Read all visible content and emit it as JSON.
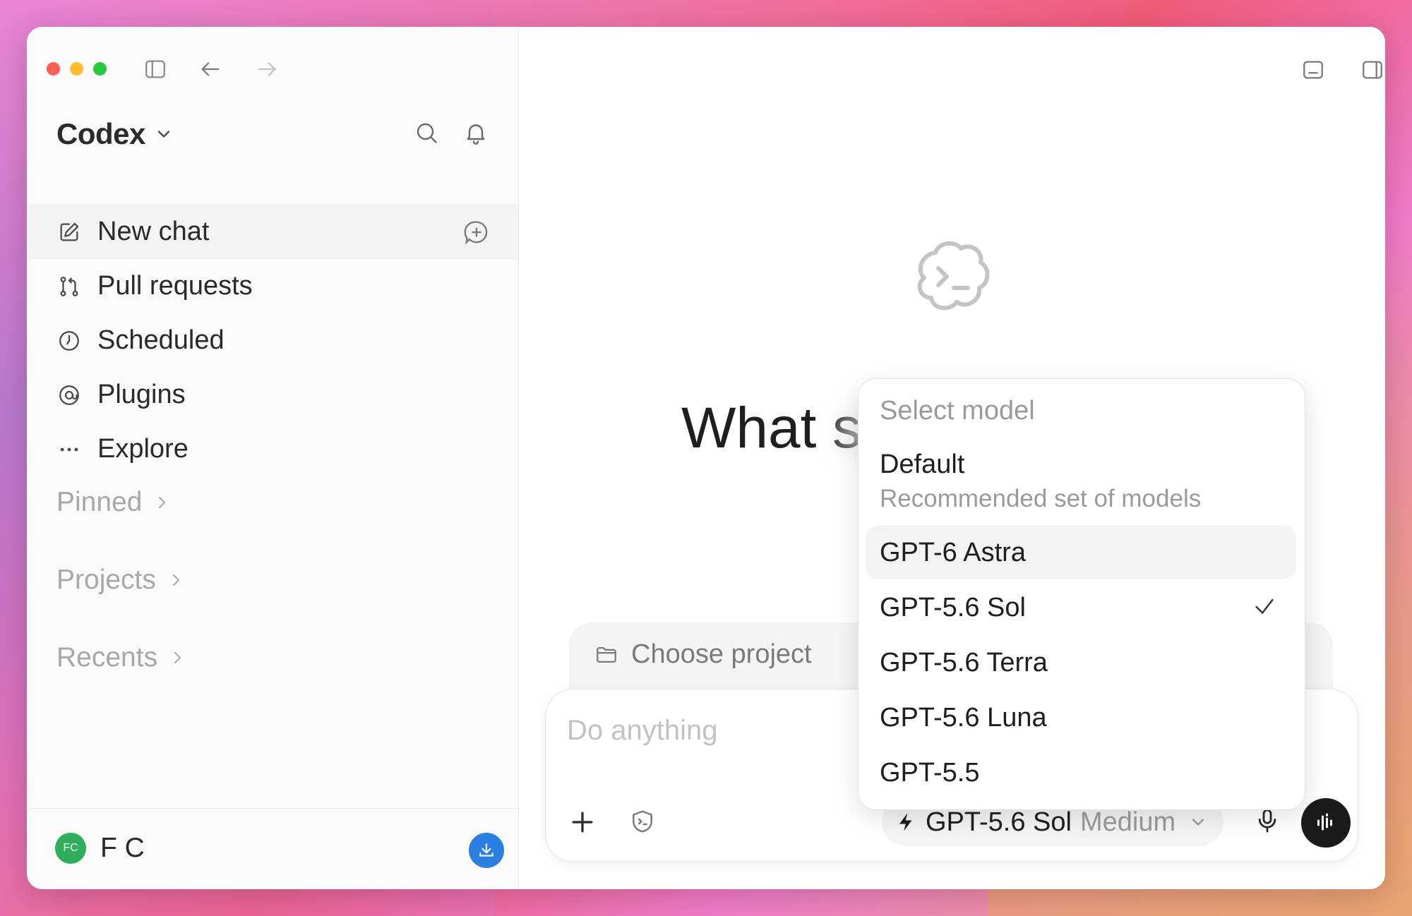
{
  "sidebar": {
    "brand": "Codex",
    "nav": [
      {
        "label": "New chat",
        "icon": "compose-icon"
      },
      {
        "label": "Pull requests",
        "icon": "pull-request-icon"
      },
      {
        "label": "Scheduled",
        "icon": "clock-icon"
      },
      {
        "label": "Plugins",
        "icon": "plugin-icon"
      },
      {
        "label": "Explore",
        "icon": "ellipsis-icon"
      }
    ],
    "sections": [
      {
        "label": "Pinned"
      },
      {
        "label": "Projects"
      },
      {
        "label": "Recents"
      }
    ],
    "user": {
      "initials": "FC",
      "name": "F C"
    }
  },
  "main": {
    "hero_text": "What s",
    "project": {
      "label": "Choose project"
    },
    "composer": {
      "placeholder": "Do anything",
      "model_name": "GPT-5.6 Sol",
      "model_effort": "Medium"
    }
  },
  "model_menu": {
    "header": "Select model",
    "default_label": "Default",
    "default_sub": "Recommended set of models",
    "items": [
      {
        "label": "GPT-6 Astra",
        "hovered": true,
        "selected": false
      },
      {
        "label": "GPT-5.6 Sol",
        "hovered": false,
        "selected": true
      },
      {
        "label": "GPT-5.6 Terra",
        "hovered": false,
        "selected": false
      },
      {
        "label": "GPT-5.6 Luna",
        "hovered": false,
        "selected": false
      },
      {
        "label": "GPT-5.5",
        "hovered": false,
        "selected": false
      }
    ]
  },
  "colors": {
    "avatar": "#2fae5b",
    "download_button": "#2b7fe0",
    "voice_button": "#1b1b1b"
  }
}
